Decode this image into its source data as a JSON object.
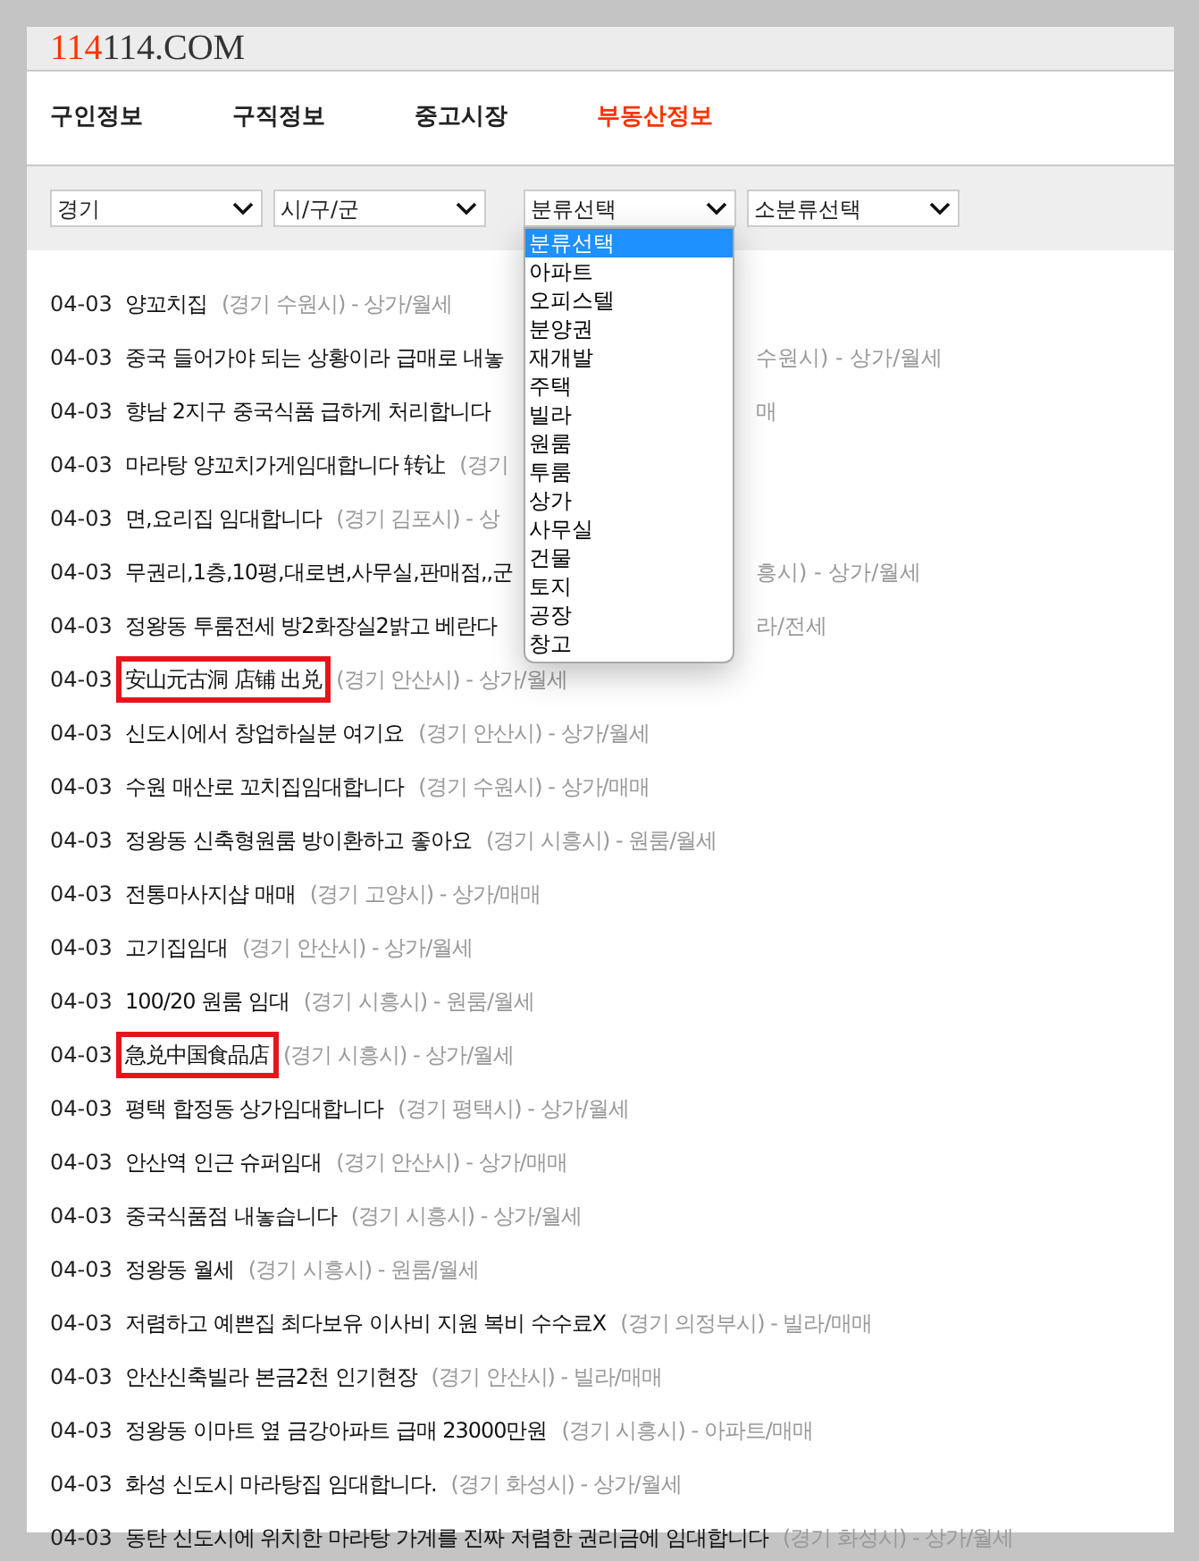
{
  "logo": {
    "accent": "114",
    "rest": "114.COM"
  },
  "tabs": [
    {
      "label": "구인정보",
      "selected": false
    },
    {
      "label": "구직정보",
      "selected": false
    },
    {
      "label": "중고시장",
      "selected": false
    },
    {
      "label": "부동산정보",
      "selected": true
    }
  ],
  "filters": [
    {
      "value": "경기",
      "open": false
    },
    {
      "value": "시/구/군",
      "open": false
    },
    {
      "value": "분류선택",
      "open": true
    },
    {
      "value": "소분류선택",
      "open": false
    }
  ],
  "dropdown_options": [
    {
      "label": "분류선택",
      "selected": true
    },
    {
      "label": "아파트",
      "selected": false
    },
    {
      "label": "오피스텔",
      "selected": false
    },
    {
      "label": "분양권",
      "selected": false
    },
    {
      "label": "재개발",
      "selected": false
    },
    {
      "label": "주택",
      "selected": false
    },
    {
      "label": "빌라",
      "selected": false
    },
    {
      "label": "원룸",
      "selected": false
    },
    {
      "label": "투룸",
      "selected": false
    },
    {
      "label": "상가",
      "selected": false
    },
    {
      "label": "사무실",
      "selected": false
    },
    {
      "label": "건물",
      "selected": false
    },
    {
      "label": "토지",
      "selected": false
    },
    {
      "label": "공장",
      "selected": false
    },
    {
      "label": "창고",
      "selected": false
    }
  ],
  "listings": [
    {
      "date": "04-03",
      "title": "양꼬치집",
      "meta": "(경기 수원시) - 상가/월세",
      "highlighted": false
    },
    {
      "date": "04-03",
      "title": "중국 들어가야 되는 상황이라 급매로 내놓",
      "tail": "수원시) - 상가/월세",
      "highlighted": false
    },
    {
      "date": "04-03",
      "title": "향남 2지구 중국식품 급하게 처리합니다",
      "tail": "매",
      "highlighted": false
    },
    {
      "date": "04-03",
      "title": "마라탕 양꼬치가게임대합니다 转让",
      "meta": "(경기",
      "highlighted": false
    },
    {
      "date": "04-03",
      "title": "면,요리집 임대합니다",
      "meta": "(경기 김포시) - 상",
      "highlighted": false
    },
    {
      "date": "04-03",
      "title": "무권리,1층,10평,대로변,사무실,판매점,,군",
      "tail": "흥시) - 상가/월세",
      "highlighted": false
    },
    {
      "date": "04-03",
      "title": "정왕동 투룸전세 방2화장실2밝고 베란다",
      "tail": "라/전세",
      "highlighted": false
    },
    {
      "date": "04-03",
      "title": "安山元古洞 店铺 出兑",
      "meta": "(경기 안산시) - 상가/월세",
      "highlighted": true
    },
    {
      "date": "04-03",
      "title": "신도시에서 창업하실분 여기요",
      "meta": "(경기 안산시) - 상가/월세",
      "highlighted": false
    },
    {
      "date": "04-03",
      "title": "수원 매산로 꼬치집임대합니다",
      "meta": "(경기 수원시) - 상가/매매",
      "highlighted": false
    },
    {
      "date": "04-03",
      "title": "정왕동 신축형원룸 방이환하고 좋아요",
      "meta": "(경기 시흥시) - 원룸/월세",
      "highlighted": false
    },
    {
      "date": "04-03",
      "title": "전통마사지샵 매매",
      "meta": "(경기 고양시) - 상가/매매",
      "highlighted": false
    },
    {
      "date": "04-03",
      "title": "고기집임대",
      "meta": "(경기 안산시) - 상가/월세",
      "highlighted": false
    },
    {
      "date": "04-03",
      "title": "100/20 원룸 임대",
      "meta": "(경기 시흥시) - 원룸/월세",
      "highlighted": false
    },
    {
      "date": "04-03",
      "title": "急兑中国食品店",
      "meta": "(경기 시흥시) - 상가/월세",
      "highlighted": true
    },
    {
      "date": "04-03",
      "title": "평택 합정동 상가임대합니다",
      "meta": "(경기 평택시) - 상가/월세",
      "highlighted": false
    },
    {
      "date": "04-03",
      "title": "안산역 인근 슈퍼임대",
      "meta": "(경기 안산시) - 상가/매매",
      "highlighted": false
    },
    {
      "date": "04-03",
      "title": "중국식품점 내놓습니다",
      "meta": "(경기 시흥시) - 상가/월세",
      "highlighted": false
    },
    {
      "date": "04-03",
      "title": "정왕동 월세",
      "meta": "(경기 시흥시) - 원룸/월세",
      "highlighted": false
    },
    {
      "date": "04-03",
      "title": "저렴하고 예쁜집 최다보유 이사비 지원 복비 수수료X",
      "meta": "(경기 의정부시) - 빌라/매매",
      "highlighted": false
    },
    {
      "date": "04-03",
      "title": "안산신축빌라 본금2천 인기현장",
      "meta": "(경기 안산시) - 빌라/매매",
      "highlighted": false
    },
    {
      "date": "04-03",
      "title": "정왕동 이마트 옆 금강아파트 급매 23000만원",
      "meta": "(경기 시흥시) - 아파트/매매",
      "highlighted": false
    },
    {
      "date": "04-03",
      "title": "화성 신도시 마라탕집 임대합니다.",
      "meta": "(경기 화성시) - 상가/월세",
      "highlighted": false
    },
    {
      "date": "04-03",
      "title": "동탄 신도시에 위치한 마라탕 가게를 진짜 저렴한 권리금에 임대합니다",
      "meta": "(경기 화성시) - 상가/월세",
      "highlighted": false
    }
  ]
}
